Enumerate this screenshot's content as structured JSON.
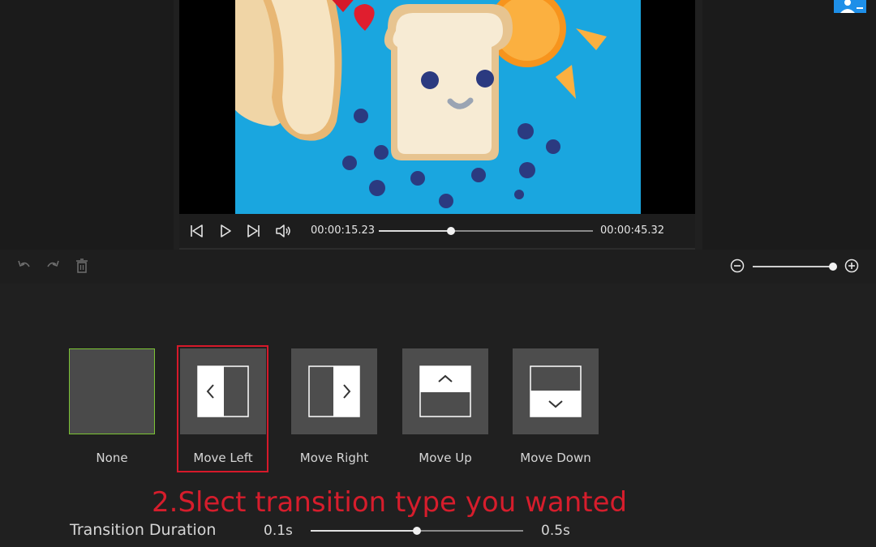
{
  "player": {
    "current_time": "00:00:15.23",
    "total_time": "00:00:45.32",
    "progress": 0.336,
    "controls": [
      "skip-back-icon",
      "play-icon",
      "skip-forward-icon",
      "volume-icon"
    ]
  },
  "toolbar": {
    "icons": [
      "undo-icon",
      "redo-icon",
      "trash-icon"
    ],
    "zoom_level": 1.0,
    "zoom_icons": [
      "zoom-out-icon",
      "zoom-in-icon"
    ]
  },
  "transitions": [
    {
      "id": "none",
      "label": "None",
      "selected": true
    },
    {
      "id": "move-left",
      "label": "Move Left",
      "selected": false
    },
    {
      "id": "move-right",
      "label": "Move Right",
      "selected": false
    },
    {
      "id": "move-up",
      "label": "Move Up",
      "selected": false
    },
    {
      "id": "move-down",
      "label": "Move Down",
      "selected": false
    }
  ],
  "instruction": "2.Slect transition type you wanted",
  "duration": {
    "label": "Transition Duration",
    "min_label": "0.1s",
    "max_label": "0.5s",
    "value_fraction": 0.5
  },
  "colors": {
    "accent_green": "#7cc534",
    "highlight_red": "#d6192a",
    "user_badge_blue": "#1e8fe8",
    "preview_background": "#1aa6df"
  }
}
